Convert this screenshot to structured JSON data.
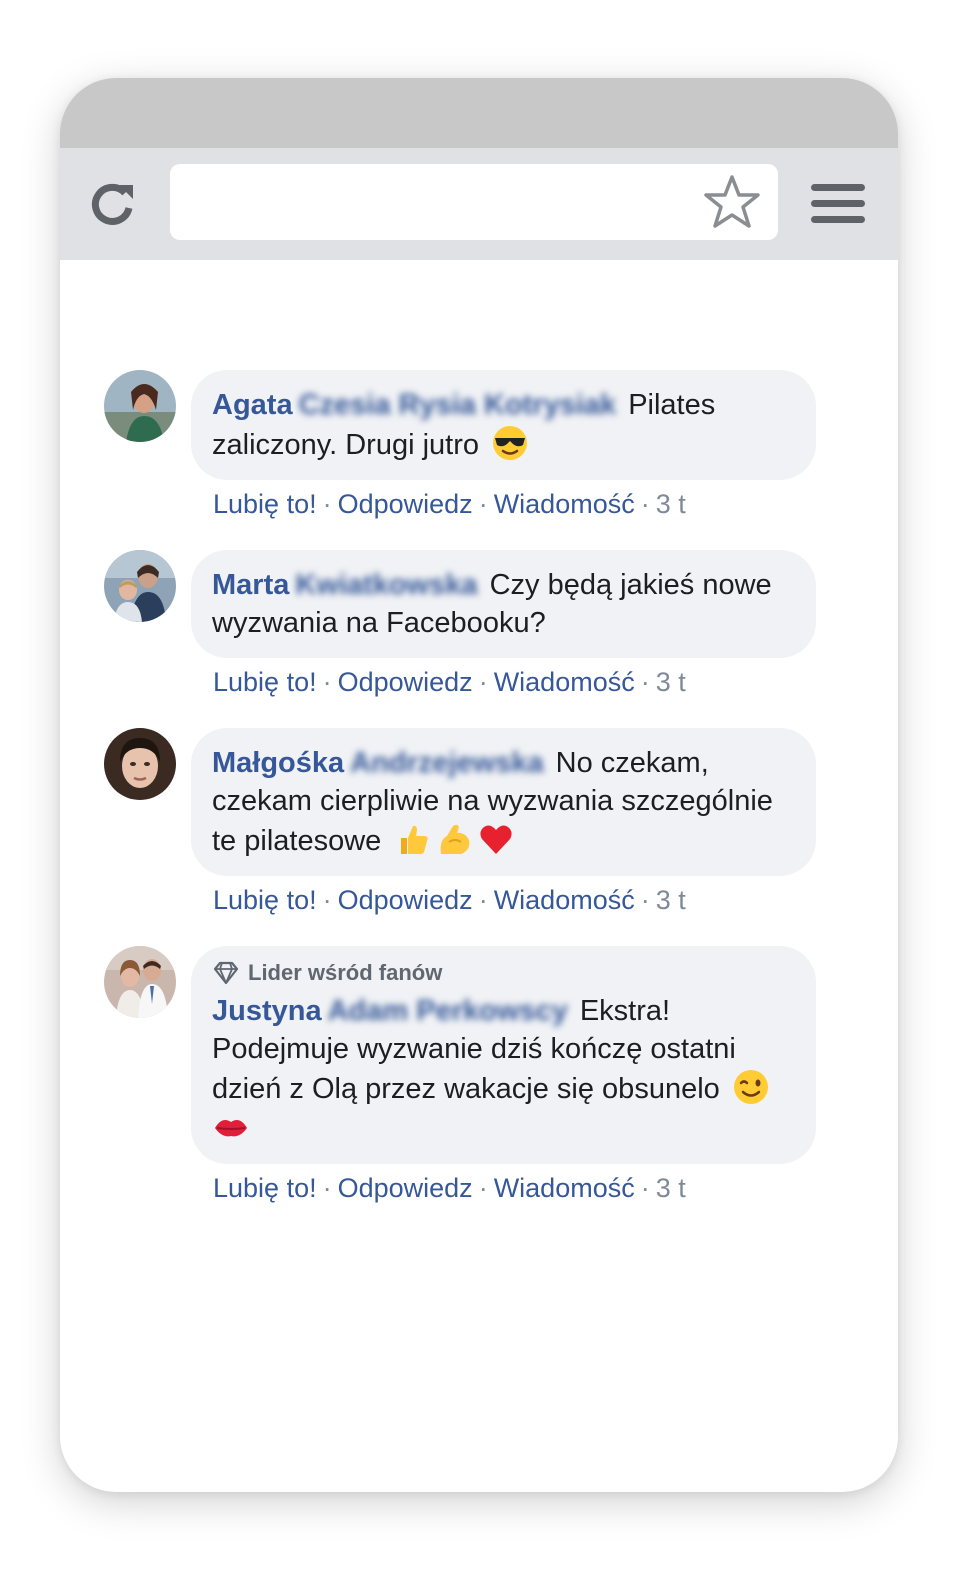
{
  "browser": {
    "reload_icon": "reload-icon",
    "star_icon": "star-icon",
    "menu_icon": "hamburger-menu-icon"
  },
  "colors": {
    "link": "#365899",
    "bubble_bg": "#f0f2f5",
    "meta": "#7f8a99"
  },
  "comments": [
    {
      "author_first": "Agata",
      "author_rest": "Czesia Rysia Kotrysiak",
      "text": "Pilates zaliczony. Drugi jutro",
      "emojis": [
        "sunglasses-emoji"
      ],
      "actions": {
        "like": "Lubię to!",
        "reply": "Odpowiedz",
        "message": "Wiadomość",
        "time": "3 t"
      }
    },
    {
      "author_first": "Marta",
      "author_rest": "Kwiatkowska",
      "text": "Czy będą jakieś nowe wyzwania na Facebooku?",
      "emojis": [],
      "actions": {
        "like": "Lubię to!",
        "reply": "Odpowiedz",
        "message": "Wiadomość",
        "time": "3 t"
      }
    },
    {
      "author_first": "Małgośka",
      "author_rest": "Andrzejewska",
      "text": "No czekam, czekam cierpliwie na wyzwania szczególnie te pilatesowe",
      "emojis": [
        "thumbs-up-emoji",
        "flexed-biceps-emoji",
        "red-heart-emoji"
      ],
      "actions": {
        "like": "Lubię to!",
        "reply": "Odpowiedz",
        "message": "Wiadomość",
        "time": "3 t"
      }
    },
    {
      "badge": "Lider wśród fanów",
      "author_first": "Justyna",
      "author_rest": "Adam Perkowscy",
      "text": "Ekstra! Podejmuje wyzwanie dziś kończę ostatni dzień z Olą przez wakacje się obsunelo",
      "emojis": [
        "winking-face-emoji",
        "kiss-mark-emoji"
      ],
      "actions": {
        "like": "Lubię to!",
        "reply": "Odpowiedz",
        "message": "Wiadomość",
        "time": "3 t"
      }
    }
  ]
}
